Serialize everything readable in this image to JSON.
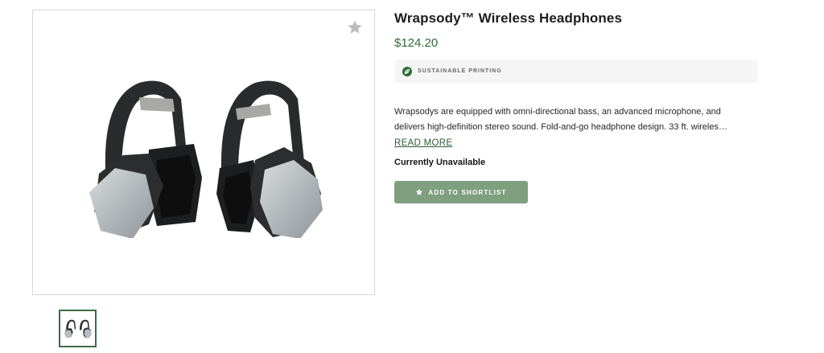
{
  "product": {
    "title": "Wrapsody™ Wireless Headphones",
    "price": "$124.20",
    "badge": "SUSTAINABLE PRINTING",
    "description_line1": "Wrapsodys are equipped with omni-directional bass, an advanced microphone, and",
    "description_line2": "delivers high-definition stereo sound. Fold-and-go headphone design. 33 ft. wireles…",
    "read_more": "READ MORE",
    "availability": "Currently Unavailable",
    "shortlist_button": "ADD TO SHORTLIST"
  },
  "gallery": {
    "main_image": "headphones-product-image",
    "thumbnails": [
      "headphones-thumbnail"
    ],
    "favorite_icon": "star-icon"
  },
  "colors": {
    "brand_green": "#2f6b3a",
    "button_green": "#7f9f7f",
    "badge_bg": "#f5f5f5"
  }
}
